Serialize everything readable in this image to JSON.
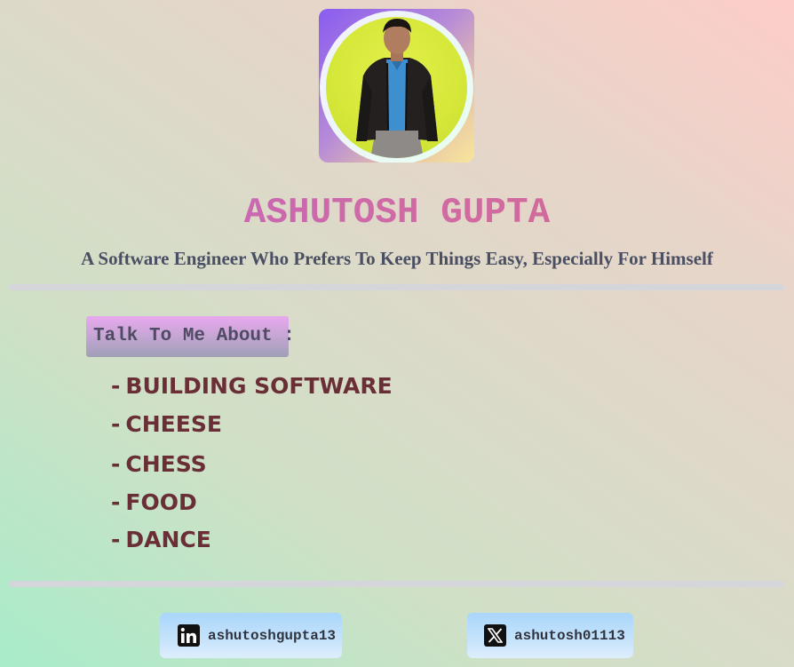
{
  "profile": {
    "name": "ASHUTOSH GUPTA",
    "tagline": "A Software Engineer Who Prefers To Keep Things Easy, Especially For Himself"
  },
  "talk": {
    "heading": "Talk To Me About :",
    "dash": "-",
    "topics": [
      "BUILDING SOFTWARE",
      "CHEESE",
      "CHESS",
      "FOOD",
      "DANCE"
    ]
  },
  "socials": {
    "linkedin": {
      "handle": "ashutoshgupta13",
      "icon": "linkedin-icon"
    },
    "x": {
      "handle": "ashutosh01113",
      "icon": "x-icon"
    }
  },
  "colors": {
    "name_gradient": [
      "#c065c4",
      "#d46a8e"
    ],
    "topic_text": "#6a2f36",
    "tagline_text": "#4a4f63",
    "social_button_bg": "#c6e3fb"
  }
}
